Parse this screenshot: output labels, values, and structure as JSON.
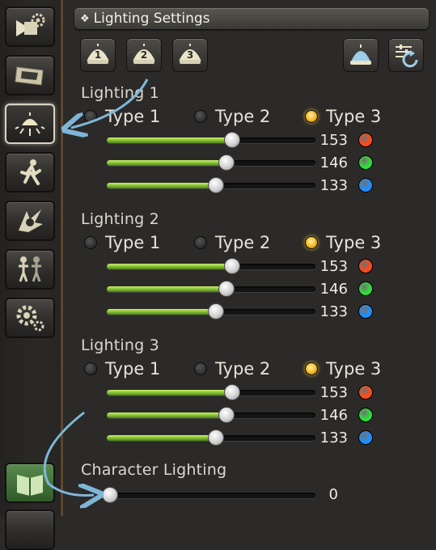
{
  "header": {
    "title": "Lighting Settings"
  },
  "sidebar": {
    "items": [
      {
        "name": "camera-settings-button",
        "icon": "camera-gear-icon",
        "active": false
      },
      {
        "name": "frame-settings-button",
        "icon": "frame-icon",
        "active": false
      },
      {
        "name": "lighting-settings-button",
        "icon": "lamp-icon",
        "active": true
      },
      {
        "name": "pose-settings-button",
        "icon": "running-figure-icon",
        "active": false
      },
      {
        "name": "effects-settings-button",
        "icon": "effect-burst-icon",
        "active": false
      },
      {
        "name": "characters-settings-button",
        "icon": "two-figures-icon",
        "active": false
      },
      {
        "name": "general-settings-button",
        "icon": "gears-icon",
        "active": false
      },
      {
        "name": "guide-button",
        "icon": "book-icon",
        "active": false
      }
    ]
  },
  "toolbar": {
    "presets": [
      "1",
      "2",
      "3"
    ],
    "light_toggle_icon": "lamp-dome-icon",
    "reset_icon": "reset-sliders-icon"
  },
  "lightings": [
    {
      "label": "Lighting 1",
      "types": [
        "Type 1",
        "Type 2",
        "Type 3"
      ],
      "selected_type": 2,
      "channels": [
        {
          "value": "153",
          "level": 153,
          "color": "#ff4a1c"
        },
        {
          "value": "146",
          "level": 146,
          "color": "#2ee03a"
        },
        {
          "value": "133",
          "level": 133,
          "color": "#1e8fff"
        }
      ]
    },
    {
      "label": "Lighting 2",
      "types": [
        "Type 1",
        "Type 2",
        "Type 3"
      ],
      "selected_type": 2,
      "channels": [
        {
          "value": "153",
          "level": 153,
          "color": "#ff4a1c"
        },
        {
          "value": "146",
          "level": 146,
          "color": "#2ee03a"
        },
        {
          "value": "133",
          "level": 133,
          "color": "#1e8fff"
        }
      ]
    },
    {
      "label": "Lighting 3",
      "types": [
        "Type 1",
        "Type 2",
        "Type 3"
      ],
      "selected_type": 2,
      "channels": [
        {
          "value": "153",
          "level": 153,
          "color": "#ff4a1c"
        },
        {
          "value": "146",
          "level": 146,
          "color": "#2ee03a"
        },
        {
          "value": "133",
          "level": 133,
          "color": "#1e8fff"
        }
      ]
    }
  ],
  "character_lighting": {
    "label": "Character Lighting",
    "value": "0",
    "level": 0
  },
  "slider_max": 255,
  "colors": {
    "accent_green": "#8dc63f",
    "selected_radio": "#f3b521",
    "arrow": "#7fb6d8"
  }
}
